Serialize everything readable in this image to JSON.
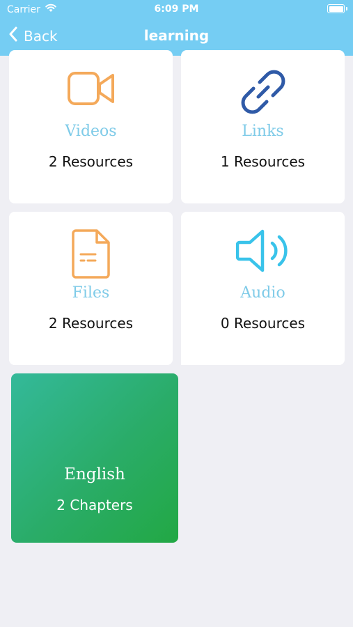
{
  "status_bar": {
    "carrier": "Carrier",
    "time": "6:09 PM"
  },
  "nav": {
    "back_label": "Back",
    "title": "learning"
  },
  "resources": [
    {
      "title": "Videos",
      "count": "2 Resources",
      "icon": "video-camera-icon",
      "icon_color": "#f4a95a"
    },
    {
      "title": "Links",
      "count": "1 Resources",
      "icon": "link-icon",
      "icon_color": "#2f5aa7"
    },
    {
      "title": "Files",
      "count": "2 Resources",
      "icon": "file-icon",
      "icon_color": "#f4a95a"
    },
    {
      "title": "Audio",
      "count": "0 Resources",
      "icon": "speaker-icon",
      "icon_color": "#39c3ea"
    }
  ],
  "course": {
    "name": "English",
    "chapters": "2 Chapters",
    "gradient_start": "#34b99a",
    "gradient_end": "#22a844"
  },
  "colors": {
    "header": "#75cdf3",
    "background": "#efeff4",
    "card_title": "#7fcbe8"
  }
}
